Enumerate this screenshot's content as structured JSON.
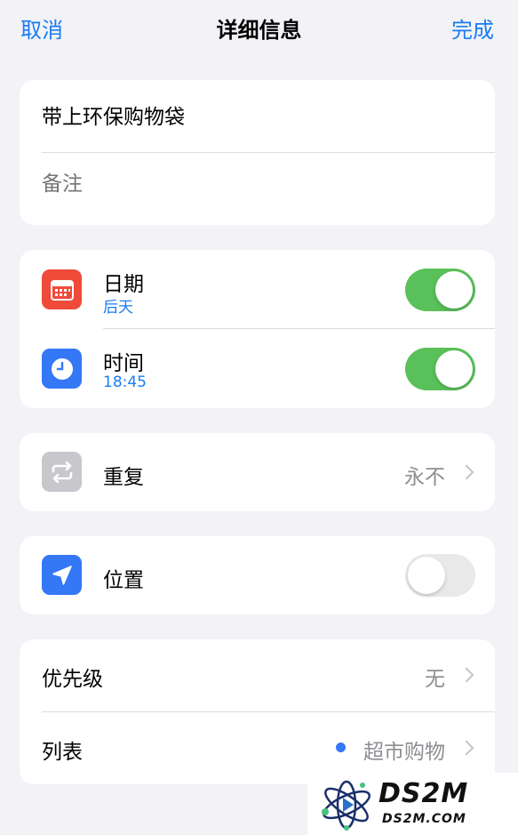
{
  "navbar": {
    "cancel_label": "取消",
    "title": "详细信息",
    "done_label": "完成",
    "accent_color": "#1a7cf3"
  },
  "reminder": {
    "title": "带上环保购物袋",
    "notes_placeholder": "备注"
  },
  "date": {
    "label": "日期",
    "value": "后天",
    "enabled": true,
    "icon": "calendar-icon",
    "icon_color": "#ef4a3a"
  },
  "time": {
    "label": "时间",
    "value": "18:45",
    "enabled": true,
    "icon": "clock-icon",
    "icon_color": "#3478f6"
  },
  "repeat": {
    "label": "重复",
    "value": "永不",
    "icon": "repeat-icon",
    "icon_color": "#c7c7cc"
  },
  "location": {
    "label": "位置",
    "enabled": false,
    "icon": "location-arrow-icon",
    "icon_color": "#3478f6"
  },
  "priority": {
    "label": "优先级",
    "value": "无"
  },
  "list": {
    "label": "列表",
    "value": "超市购物",
    "dot_color": "#3478f6"
  },
  "toggle_colors": {
    "on": "#5ac05a",
    "off": "#e9e9ea"
  },
  "watermark": {
    "main": "DS2M",
    "sub": "DS2M.COM"
  }
}
